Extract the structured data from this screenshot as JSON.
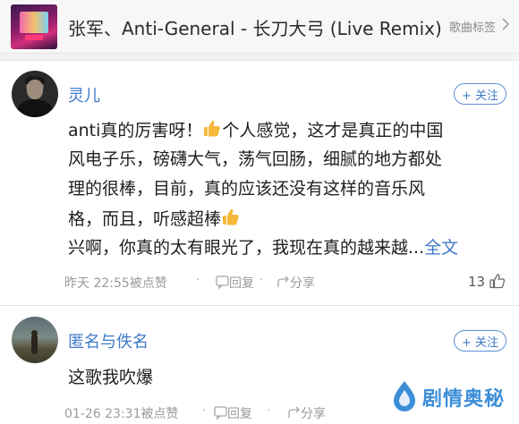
{
  "song": {
    "title": "张军、Anti-General - 长刀大弓 (Live Remix)",
    "tag_label": "歌曲标签",
    "cover_icon": "album-cover"
  },
  "comments": [
    {
      "username": "灵儿",
      "follow_label": "+ 关注",
      "lines": [
        {
          "before": "anti真的厉害呀！",
          "icon": "thumbs-up-emoji",
          "after": "个人感觉，这才是真正的中国"
        },
        {
          "text": "风电子乐，磅礴大气，荡气回肠，细腻的地方都处"
        },
        {
          "text": "理的很棒，目前，真的应该还没有这样的音乐风"
        },
        {
          "before": "格，而且，听感超棒",
          "icon": "thumbs-up-emoji"
        },
        {
          "text": "兴啊，你真的太有眼光了，我现在真的越来越...",
          "link": "全文"
        }
      ],
      "time": "昨天 22:55",
      "liked_by": "被点赞",
      "reply_label": "回复",
      "share_label": "分享",
      "like_count": "13"
    },
    {
      "username": "匿名与佚名",
      "follow_label": "+ 关注",
      "lines": [
        {
          "text": "这歌我吹爆"
        }
      ],
      "time": "01-26 23:31",
      "liked_by": "被点赞",
      "reply_label": "回复",
      "share_label": "分享"
    }
  ],
  "watermark": {
    "text": "剧情奥秘",
    "icon": "watermark-logo"
  },
  "colors": {
    "link": "#3f79c8",
    "meta": "#9a9a9a",
    "thumb": "#f5b83a"
  }
}
